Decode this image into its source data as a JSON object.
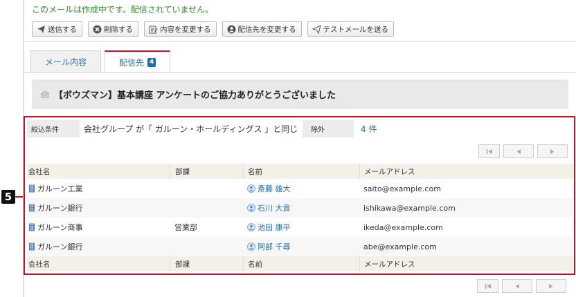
{
  "notice": "このメールは作成中です。配信されていません。",
  "toolbar": {
    "send": "送信する",
    "delete": "削除する",
    "edit_content": "内容を変更する",
    "edit_recipients": "配信先を変更する",
    "test_mail": "テストメールを送る"
  },
  "tabs": {
    "content": "メール内容",
    "recipients": "配信先",
    "recipients_count": "4"
  },
  "subject": "【ボウズマン】基本講座 アンケートのご協力ありがとうございました",
  "filter": {
    "label": "絞込条件",
    "value": "会社グループ が「 ガルーン・ホールディングス 」と同じ",
    "exclude_label": "除外",
    "exclude_count": "4 件"
  },
  "table": {
    "headers": [
      "会社名",
      "部課",
      "名前",
      "メールアドレス"
    ],
    "rows": [
      {
        "company": "ガルーン工業",
        "dept": "",
        "name": "斎藤 雄大",
        "email": "saito@example.com"
      },
      {
        "company": "ガルーン銀行",
        "dept": "",
        "name": "石川 大貴",
        "email": "ishikawa@example.com"
      },
      {
        "company": "ガルーン商事",
        "dept": "営業部",
        "name": "池田 康平",
        "email": "ikeda@example.com"
      },
      {
        "company": "ガルーン銀行",
        "dept": "",
        "name": "阿部 千尋",
        "email": "abe@example.com"
      }
    ]
  },
  "marker": "5",
  "colors": {
    "notice_green": "#2e8b2e",
    "link_blue": "#1f6fa9",
    "highlight_red": "#c8102e",
    "header_bg": "#f3f0e8"
  }
}
